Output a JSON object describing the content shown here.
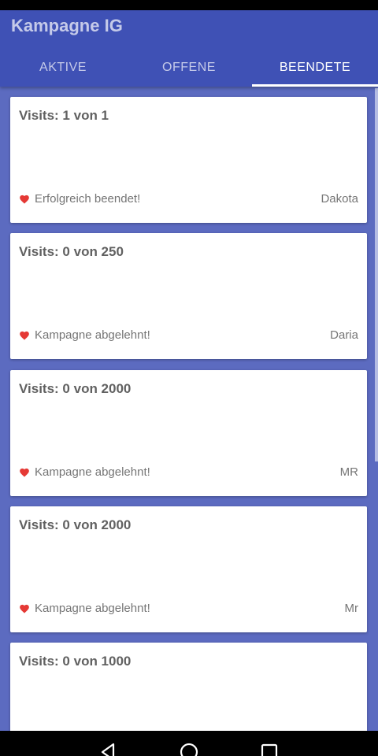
{
  "app": {
    "title": "Kampagne IG"
  },
  "tabs": [
    {
      "label": "AKTIVE",
      "active": false
    },
    {
      "label": "OFFENE",
      "active": false
    },
    {
      "label": "BEENDETE",
      "active": true
    }
  ],
  "campaigns": [
    {
      "title": "Visits: 1 von 1",
      "status": "Erfolgreich beendet!",
      "user": "Dakota",
      "icon": "heart-icon"
    },
    {
      "title": "Visits: 0 von 250",
      "status": "Kampagne abgelehnt!",
      "user": "Daria",
      "icon": "heart-icon"
    },
    {
      "title": "Visits: 0 von 2000",
      "status": "Kampagne abgelehnt!",
      "user": "MR",
      "icon": "heart-icon"
    },
    {
      "title": "Visits: 0 von 2000",
      "status": "Kampagne abgelehnt!",
      "user": "Mr",
      "icon": "heart-icon"
    },
    {
      "title": "Visits: 0 von 1000",
      "status": "",
      "user": "",
      "icon": "heart-icon"
    }
  ],
  "colors": {
    "primary": "#3f51b5",
    "background": "#5c6bc0",
    "heart": "#e53935"
  },
  "nav": {
    "icons": [
      "back-icon",
      "home-icon",
      "recents-icon"
    ]
  }
}
